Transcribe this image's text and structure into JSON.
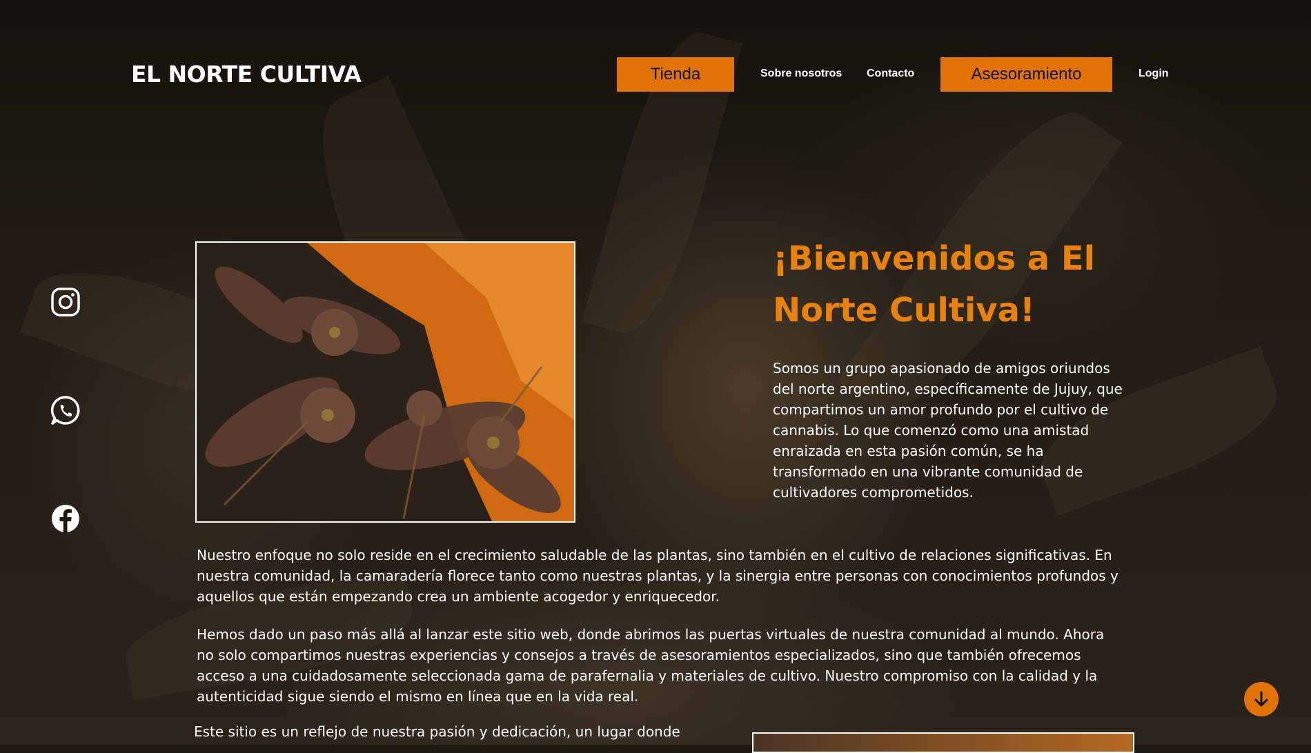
{
  "header": {
    "brand": "EL NORTE CULTIVA",
    "nav": {
      "tienda": "Tienda",
      "sobre": "Sobre nosotros",
      "contacto": "Contacto",
      "asesoramiento": "Asesoramiento",
      "login": "Login"
    }
  },
  "social": {
    "icons": [
      "instagram-icon",
      "whatsapp-icon",
      "facebook-icon"
    ]
  },
  "hero": {
    "title": "¡Bienvenidos a El Norte Cultiva!",
    "intro": "Somos un grupo apasionado de amigos oriundos del norte argentino, específicamente de Jujuy, que compartimos un amor profundo por el cultivo de cannabis. Lo que comenzó como una amistad enraizada en esta pasión común, se ha transformado en una vibrante comunidad de cultivadores comprometidos."
  },
  "body": {
    "p1": "Nuestro enfoque no solo reside en el crecimiento saludable de las plantas, sino también en el cultivo de relaciones significativas. En nuestra comunidad, la camaradería florece tanto como nuestras plantas, y la sinergia entre personas con conocimientos profundos y aquellos que están empezando crea un ambiente acogedor y enriquecedor.",
    "p2": "Hemos dado un paso más allá al lanzar este sitio web, donde abrimos las puertas virtuales de nuestra comunidad al mundo. Ahora no solo compartimos nuestras experiencias y consejos a través de asesoramientos especializados, sino que también ofrecemos acceso a una cuidadosamente seleccionada gama de parafernalia y materiales de cultivo. Nuestro compromiso con la calidad y la autenticidad sigue siendo el mismo en línea que en la vida real.",
    "p3": "Este sitio es un reflejo de nuestra pasión y dedicación, un lugar donde"
  },
  "colors": {
    "accent": "#e07208",
    "title": "#e8820e",
    "background": "#1d1812",
    "text": "#ffffff"
  }
}
